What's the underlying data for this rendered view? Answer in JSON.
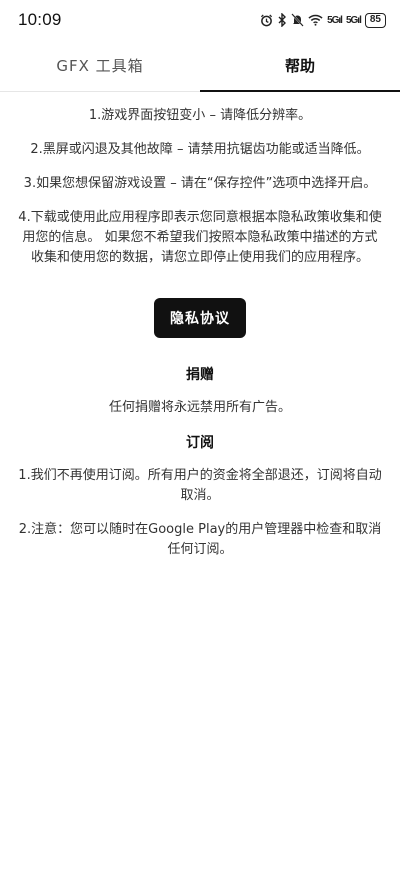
{
  "status_bar": {
    "time": "10:09",
    "alarm_icon": "alarm-clock-icon",
    "bluetooth_icon": "bluetooth-icon",
    "mute_icon": "bell-muted-icon",
    "wifi_icon": "wifi-icon",
    "signal1_label": "5Gıl",
    "signal2_label": "5Gıl",
    "battery": "85"
  },
  "tabs": [
    {
      "label": "GFX 工具箱",
      "active": false
    },
    {
      "label": "帮助",
      "active": true
    }
  ],
  "help": {
    "items": [
      "1.游戏界面按钮变小 – 请降低分辨率。",
      "2.黑屏或闪退及其他故障 – 请禁用抗锯齿功能或适当降低。",
      "3.如果您想保留游戏设置 – 请在“保存控件”选项中选择开启。",
      "4.下载或使用此应用程序即表示您同意根据本隐私政策收集和使用您的信息。 如果您不希望我们按照本隐私政策中描述的方式收集和使用您的数据，请您立即停止使用我们的应用程序。"
    ],
    "privacy_button": "隐私协议"
  },
  "donate": {
    "title": "捐赠",
    "text": "任何捐赠将永远禁用所有广告。"
  },
  "subscription": {
    "title": "订阅",
    "items": [
      "1.我们不再使用订阅。所有用户的资金将全部退还，订阅将自动取消。",
      "2.注意：您可以随时在Google Play的用户管理器中检查和取消任何订阅。"
    ]
  }
}
